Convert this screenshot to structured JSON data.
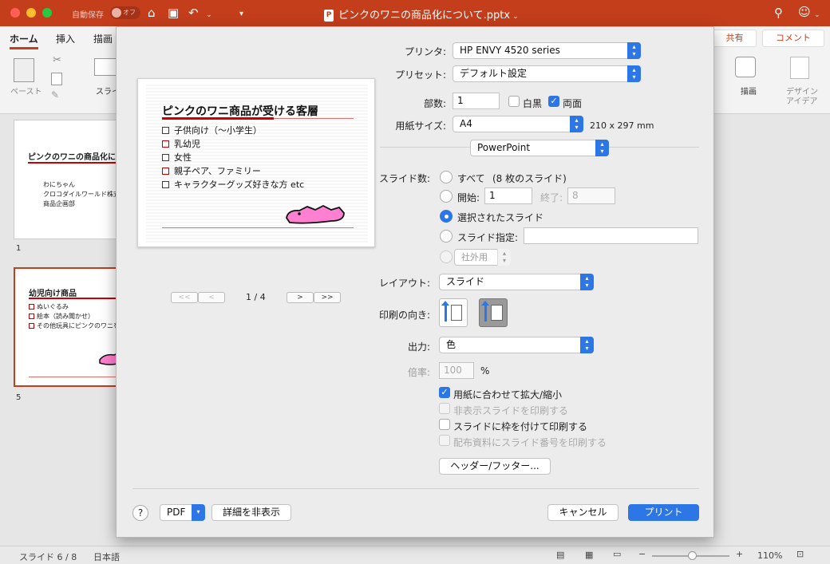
{
  "titlebar": {
    "autosave_label": "自動保存",
    "autosave_state": "オフ",
    "document_title": "ピンクのワニの商品化について.pptx",
    "file_icon_letter": "P"
  },
  "ribbon": {
    "tabs": [
      "ホーム",
      "挿入",
      "描画"
    ],
    "paste_label": "ペースト",
    "slide_label": "スライ",
    "draw_label": "描画",
    "design_label_1": "デザイン",
    "design_label_2": "アイデア",
    "share_label": "共有",
    "comment_label": "コメント"
  },
  "slides_pane": {
    "slide1": {
      "number": "1",
      "title": "ピンクのワニの商品化に",
      "lines": [
        "わにちゃん",
        "クロコダイルワールド株式会",
        "商品企画部"
      ]
    },
    "slide5": {
      "number": "5",
      "title": "幼児向け商品",
      "items": [
        "ぬいぐるみ",
        "絵本（読み聞かせ）",
        "その他玩具にピンクのワニを"
      ]
    }
  },
  "preview": {
    "title": "ピンクのワニ商品が受ける客層",
    "items": [
      "子供向け（～小学生）",
      "乳幼児",
      "女性",
      "親子ペア、ファミリー",
      "キャラクターグッズ好きな方 etc"
    ],
    "page_indicator": "1 / 4",
    "nav_first": "<<",
    "nav_prev": "<",
    "nav_next": ">",
    "nav_last": ">>"
  },
  "print": {
    "printer_label": "プリンタ:",
    "printer_value": "HP ENVY 4520 series",
    "preset_label": "プリセット:",
    "preset_value": "デフォルト設定",
    "copies_label": "部数:",
    "copies_value": "1",
    "bw_label": "白黒",
    "duplex_label": "両面",
    "paper_label": "用紙サイズ:",
    "paper_value": "A4",
    "paper_dims": "210 x 297 mm",
    "app_section": "PowerPoint",
    "slides_label": "スライド数:",
    "all_label": "すべて",
    "all_count": "(8 枚のスライド)",
    "from_label": "開始:",
    "from_value": "1",
    "to_label": "終了:",
    "to_value": "8",
    "selected_label": "選択されたスライド",
    "custom_label": "スライド指定:",
    "custom_value": "",
    "external_value": "社外用",
    "layout_label": "レイアウト:",
    "layout_value": "スライド",
    "orientation_label": "印刷の向き:",
    "output_label": "出力:",
    "output_value": "色",
    "scale_label": "倍率:",
    "scale_value": "100",
    "scale_unit": "%",
    "fit_label": "用紙に合わせて拡大/縮小",
    "hidden_label": "非表示スライドを印刷する",
    "frame_label": "スライドに枠を付けて印刷する",
    "handout_label": "配布資料にスライド番号を印刷する",
    "header_footer_button": "ヘッダー/フッター...",
    "help_label": "?",
    "pdf_label": "PDF",
    "hide_details_button": "詳細を非表示",
    "cancel_button": "キャンセル",
    "print_button": "プリント"
  },
  "statusbar": {
    "slide_position": "スライド 6 / 8",
    "language": "日本語",
    "zoom": "110%",
    "zoom_percent": 110
  }
}
